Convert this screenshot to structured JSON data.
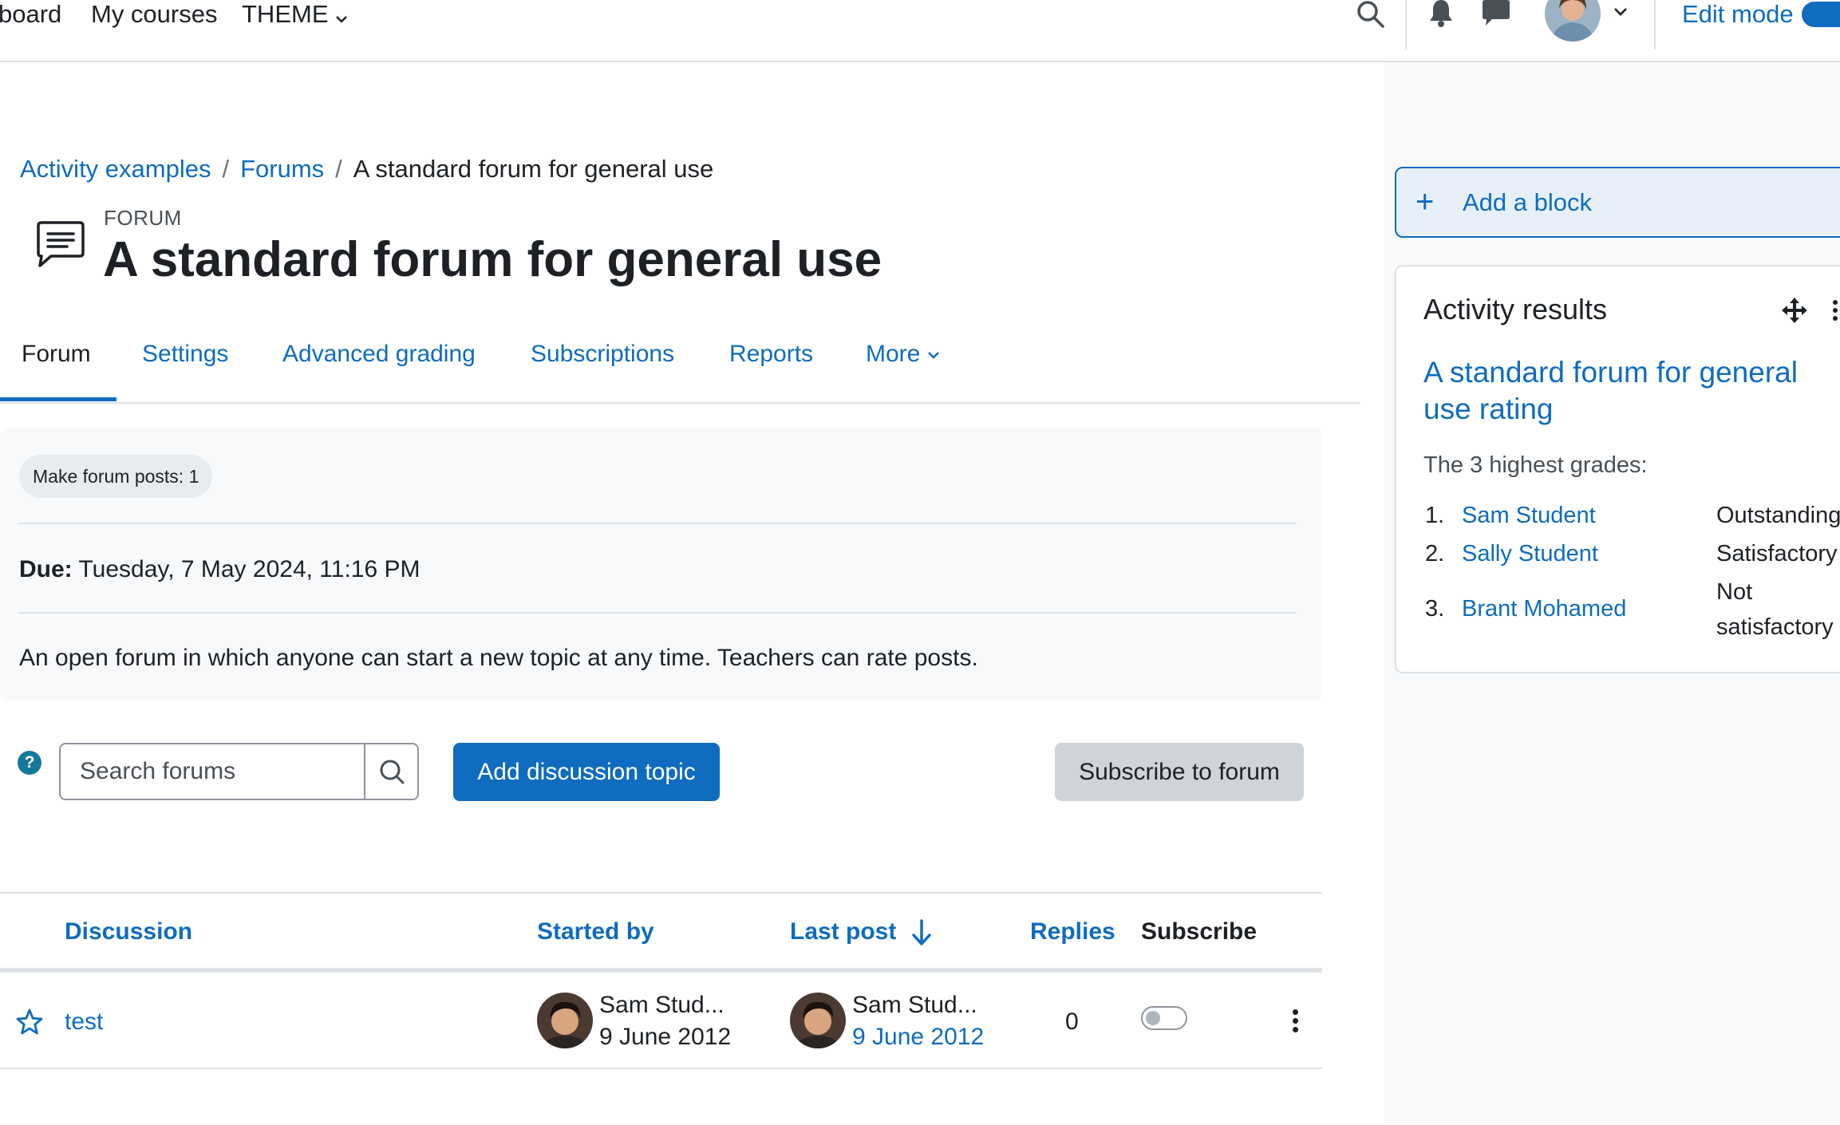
{
  "topnav": {
    "dashboard_partial": "board",
    "my_courses": "My courses",
    "theme": "THEME",
    "edit_mode": "Edit mode"
  },
  "breadcrumb": [
    "Activity examples",
    "Forums",
    "A standard forum for general use"
  ],
  "header": {
    "kicker": "FORUM",
    "title": "A standard forum for general use"
  },
  "tabs": [
    "Forum",
    "Settings",
    "Advanced grading",
    "Subscriptions",
    "Reports",
    "More"
  ],
  "activity": {
    "completion_badge": "Make forum posts: 1",
    "due_label": "Due:",
    "due_value": "Tuesday, 7 May 2024, 11:16 PM",
    "description": "An open forum in which anyone can start a new topic at any time. Teachers can rate posts."
  },
  "actions": {
    "help": "?",
    "search_placeholder": "Search forums",
    "add_topic": "Add discussion topic",
    "subscribe": "Subscribe to forum"
  },
  "table": {
    "headers": [
      "Discussion",
      "Started by",
      "Last post",
      "Replies",
      "Subscribe"
    ],
    "rows": [
      {
        "discussion": "test",
        "started_by_name": "Sam Stud...",
        "started_by_date": "9 June 2012",
        "last_post_name": "Sam Stud...",
        "last_post_date": "9 June 2012",
        "replies": "0",
        "subscribed": false
      }
    ]
  },
  "blocks": {
    "add_block": "Add a block",
    "activity_results": {
      "title": "Activity results",
      "activity_link": "A standard forum for general use rating",
      "heading": "The 3 highest grades:",
      "grades": [
        {
          "rank": "1.",
          "name": "Sam Student",
          "grade": "Outstanding"
        },
        {
          "rank": "2.",
          "name": "Sally Student",
          "grade": "Satisfactory"
        },
        {
          "rank": "3.",
          "name": "Brant Mohamed",
          "grade": "Not satisfactory"
        }
      ]
    }
  },
  "colors": {
    "brand": "#0f6cbf",
    "text": "#1d2125",
    "drawer_bg": "#f8f9fa"
  }
}
